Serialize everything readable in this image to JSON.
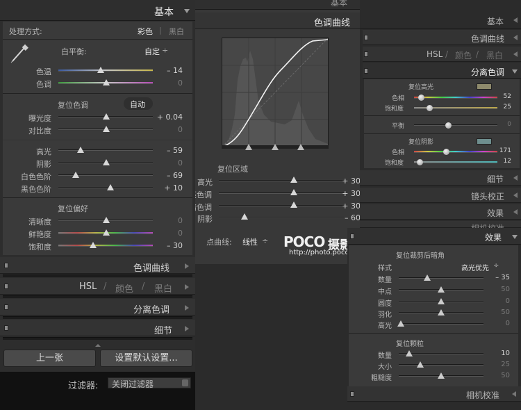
{
  "left": {
    "header": {
      "title": "基本"
    },
    "process": {
      "label": "处理方式:",
      "color": "彩色",
      "sep": "|",
      "bw": "黑白"
    },
    "wb": {
      "label": "白平衡:",
      "value": "自定",
      "arrows": "÷"
    },
    "temp": {
      "label": "色温",
      "value": "– 14"
    },
    "tint": {
      "label": "色调",
      "value": "0"
    },
    "tone_reset": "复位色调",
    "auto": "自动",
    "exposure": {
      "label": "曝光度",
      "value": "+ 0.04"
    },
    "contrast": {
      "label": "对比度",
      "value": "0"
    },
    "highlights": {
      "label": "高光",
      "value": "– 59"
    },
    "shadows": {
      "label": "阴影",
      "value": "0"
    },
    "whites": {
      "label": "白色色阶",
      "value": "– 69"
    },
    "blacks": {
      "label": "黑色色阶",
      "value": "+ 10"
    },
    "presence_reset": "复位偏好",
    "clarity": {
      "label": "清晰度",
      "value": "0"
    },
    "vibrance": {
      "label": "鲜艳度",
      "value": "0"
    },
    "saturation": {
      "label": "饱和度",
      "value": "– 30"
    },
    "sections": {
      "curve": "色调曲线",
      "hsl": "HSL",
      "hsl_sep": "/",
      "color": "颜色",
      "bw": "黑白",
      "split": "分离色调",
      "detail": "细节"
    },
    "prev_button": "上一张",
    "default_button": "设置默认设置...",
    "filter": {
      "label": "过滤器:",
      "value": "关闭过滤器"
    }
  },
  "middle": {
    "top_title": "基本",
    "curve_title": "色调曲线",
    "region_reset": "复位区域",
    "highlights": {
      "label": "高光",
      "value": "+ 30"
    },
    "lights": {
      "label": "亮色调",
      "value": "+ 30"
    },
    "darks": {
      "label": "暗色调",
      "value": "+ 30"
    },
    "shadows": {
      "label": "阴影",
      "value": "– 60"
    },
    "point_curve": {
      "label": "点曲线:",
      "value": "线性",
      "arrows": "÷"
    }
  },
  "watermark": {
    "brand": "POCO",
    "cn": "摄影专题",
    "url": "http://photo.poco.cn/"
  },
  "right": {
    "sections": {
      "basic": "基本",
      "curve": "色调曲线",
      "hsl": "HSL",
      "hsl_sep": "/",
      "color": "颜色",
      "bw": "黑白",
      "split": "分离色调",
      "detail": "细节",
      "lens": "镜头校正",
      "effects": "效果",
      "camera_partial": "相机校准",
      "effects2": "效果",
      "camera": "相机校准"
    },
    "split": {
      "hl_reset": "复位高光",
      "hl_hue": {
        "label": "色相",
        "value": "52"
      },
      "hl_sat": {
        "label": "饱和度",
        "value": "25"
      },
      "balance": {
        "label": "平衡",
        "value": "0"
      },
      "sh_reset": "复位阴影",
      "sh_hue": {
        "label": "色相",
        "value": "171"
      },
      "sh_sat": {
        "label": "饱和度",
        "value": "12"
      },
      "hl_swatch": "#8e8a6c",
      "sh_swatch": "#6e8e8e"
    },
    "vignette": {
      "reset": "复位裁剪后暗角",
      "style_label": "样式",
      "style_value": "高光优先",
      "amount": {
        "label": "数量",
        "value": "– 35"
      },
      "midpoint": {
        "label": "中点",
        "value": "50"
      },
      "roundness": {
        "label": "圆度",
        "value": "0"
      },
      "feather": {
        "label": "羽化",
        "value": "50"
      },
      "highlights": {
        "label": "高光",
        "value": "0"
      }
    },
    "grain": {
      "reset": "复位颗粒",
      "amount": {
        "label": "数量",
        "value": "10"
      },
      "size": {
        "label": "大小",
        "value": "25"
      },
      "roughness": {
        "label": "粗糙度",
        "value": "50"
      }
    }
  }
}
